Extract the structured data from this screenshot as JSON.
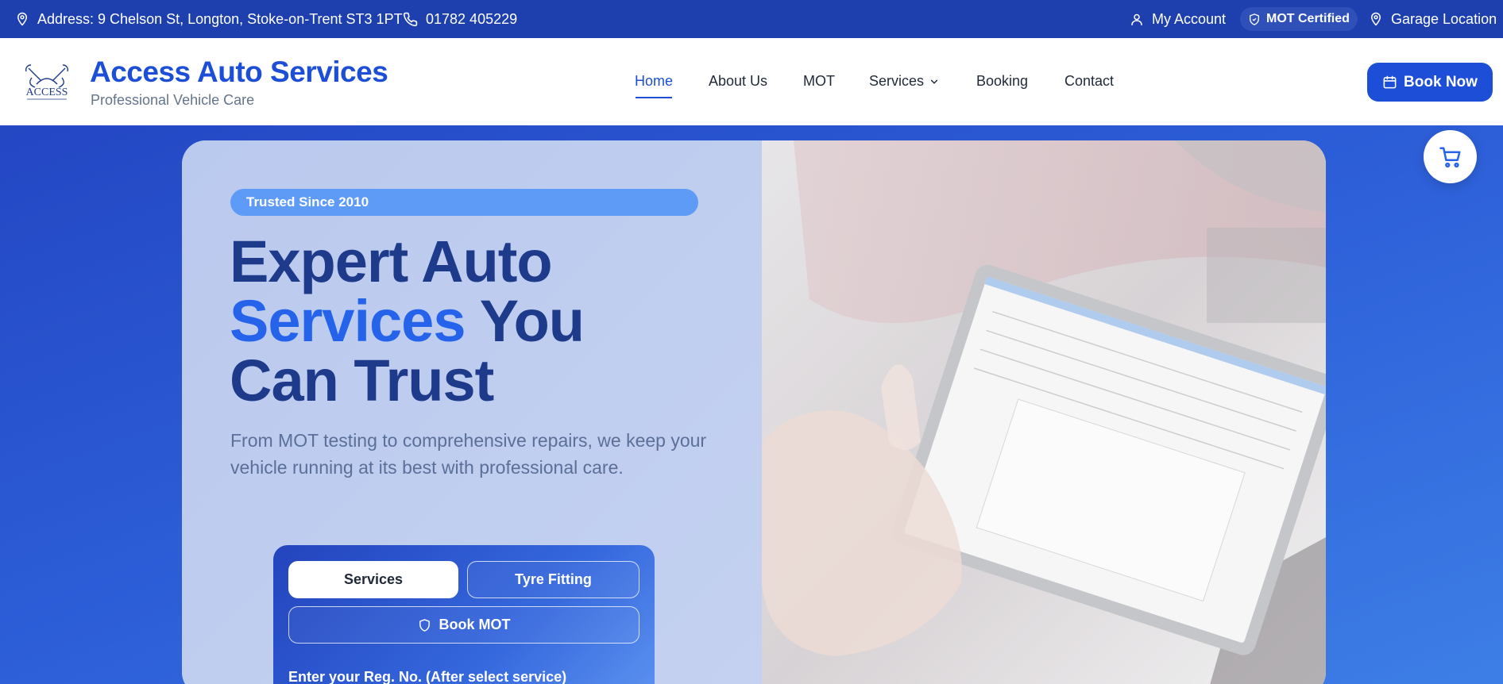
{
  "topbar": {
    "address": "Address: 9 Chelson St, Longton, Stoke-on-Trent ST3 1PT",
    "phone": "01782 405229",
    "account": "My Account",
    "mot_certified": "MOT Certified",
    "garage_location": "Garage Location"
  },
  "header": {
    "logo_text": "ACCESS",
    "brand": "Access Auto Services",
    "tagline": "Professional Vehicle Care",
    "nav": [
      "Home",
      "About Us",
      "MOT",
      "Services",
      "Booking",
      "Contact"
    ],
    "active_nav": "Home",
    "book_now": "Book Now"
  },
  "hero": {
    "badge": "Trusted Since 2010",
    "title_line1": "Expert Auto",
    "title_highlight": "Services",
    "title_line2_rest": " You",
    "title_line3": "Can Trust",
    "lead": "From MOT testing to comprehensive repairs, we keep your vehicle running at its best with professional care."
  },
  "booking_widget": {
    "tab_services": "Services",
    "tab_tyre": "Tyre Fitting",
    "book_mot": "Book MOT",
    "reg_label": "Enter your Reg. No. (After select service)"
  },
  "colors": {
    "primary": "#1d4ed8",
    "topbar": "#1e40af",
    "heading": "#1e3a8a",
    "badge": "#5e9bf7"
  },
  "icons": [
    "map-pin-icon",
    "phone-icon",
    "user-icon",
    "shield-icon",
    "calendar-icon",
    "chevron-down-icon",
    "cart-icon"
  ]
}
